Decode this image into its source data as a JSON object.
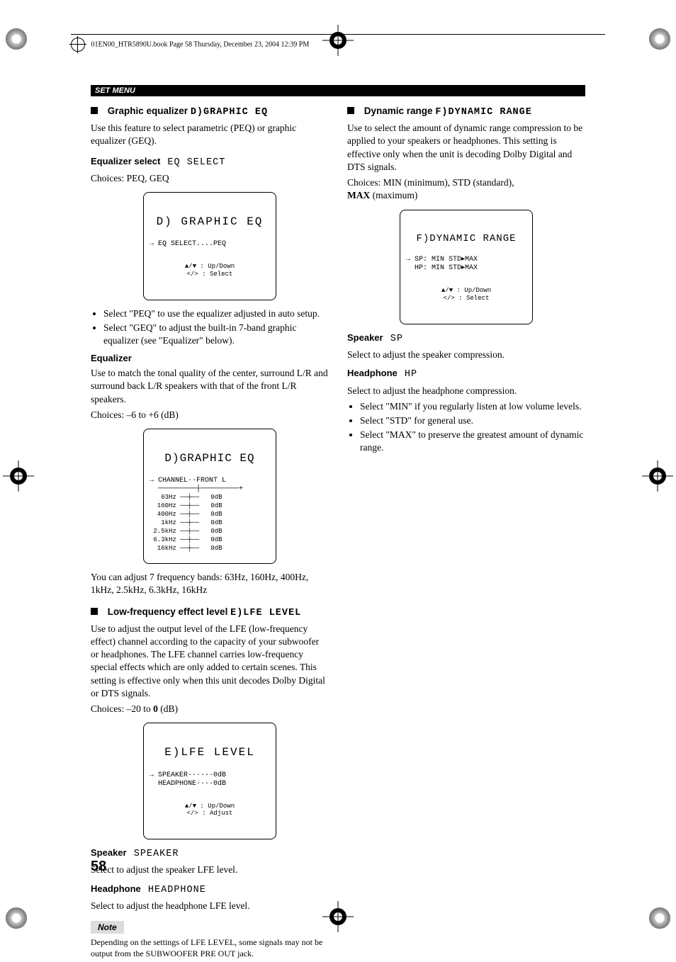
{
  "header": {
    "file_line": "01EN00_HTR5890U.book  Page 58  Thursday, December 23, 2004  12:39 PM"
  },
  "section_bar": "SET MENU",
  "page_number": "58",
  "left": {
    "h1_bold": "Graphic equalizer",
    "h1_osd": "D)GRAPHIC EQ",
    "p1": "Use this feature to select parametric (PEQ) or graphic equalizer (GEQ).",
    "eqsel_bold": "Equalizer select",
    "eqsel_osd": "EQ SELECT",
    "eqsel_choices": "Choices: PEQ, GEQ",
    "lcd1_title": "D) GRAPHIC EQ",
    "lcd1_line1": "→ EQ SELECT....PEQ",
    "lcd1_hint": "▲/▼ : Up/Down\n</> : Select",
    "bullets1": [
      "Select \"PEQ\" to use the equalizer adjusted in auto setup.",
      "Select \"GEQ\" to adjust the built-in 7-band graphic equalizer (see \"Equalizer\" below)."
    ],
    "eq_bold": "Equalizer",
    "eq_p": "Use to match the tonal quality of the center, surround L/R and surround back L/R speakers with that of the front L/R speakers.",
    "eq_choices": "Choices: –6 to +6 (dB)",
    "lcd2_title": "D)GRAPHIC EQ",
    "lcd2_line1": "→ CHANNEL··FRONT L",
    "lcd2_bands": "   63Hz ──┼──   0dB\n  160Hz ──┼──   0dB\n  400Hz ──┼──   0dB\n   1kHz ──┼──   0dB\n 2.5kHz ──┼──   0dB\n 6.3kHz ──┼──   0dB\n  16kHz ──┼──   0dB",
    "eq_after": "You can adjust 7 frequency bands: 63Hz, 160Hz, 400Hz, 1kHz, 2.5kHz, 6.3kHz, 16kHz",
    "h2_bold": "Low-frequency effect level",
    "h2_osd": "E)LFE LEVEL",
    "lfe_p": "Use to adjust the output level of the LFE (low-frequency effect) channel according to the capacity of your subwoofer or headphones. The LFE channel carries low-frequency special effects which are only added to certain scenes. This setting is effective only when this unit decodes Dolby Digital or DTS signals.",
    "lfe_choices_a": "Choices: –20 to ",
    "lfe_choices_b": "0",
    "lfe_choices_c": " (dB)",
    "lcd3_title": "E)LFE LEVEL",
    "lcd3_line1": "→ SPEAKER······0dB",
    "lcd3_line2": "  HEADPHONE····0dB",
    "lcd3_hint": "▲/▼ : Up/Down\n</> : Adjust",
    "sp_bold": "Speaker",
    "sp_osd": "SPEAKER",
    "sp_p": "Select to adjust the speaker LFE level.",
    "hp_bold": "Headphone",
    "hp_osd": "HEADPHONE",
    "hp_p": "Select to adjust the headphone LFE level.",
    "note_label": "Note",
    "note_p": "Depending on the settings of LFE LEVEL, some signals may not be output from the SUBWOOFER PRE OUT jack."
  },
  "right": {
    "h1_bold": "Dynamic range",
    "h1_osd": "F)DYNAMIC RANGE",
    "p1": "Use to select the amount of dynamic range compression to be applied to your speakers or headphones. This setting is effective only when the unit is decoding Dolby Digital and DTS signals.",
    "choices_a": "Choices: MIN (minimum), STD (standard), ",
    "choices_b": "MAX",
    "choices_c": " (maximum)",
    "lcd_title": "F)DYNAMIC RANGE",
    "lcd_line1": "→ SP: MIN STD▸MAX",
    "lcd_line2": "  HP: MIN STD▸MAX",
    "lcd_hint": "▲/▼ : Up/Down\n</> : Select",
    "sp_bold": "Speaker",
    "sp_osd": "SP",
    "sp_p": "Select to adjust the speaker compression.",
    "hp_bold": "Headphone",
    "hp_osd": "HP",
    "hp_p": "Select to adjust the headphone compression.",
    "bullets": [
      "Select \"MIN\" if you regularly listen at low volume levels.",
      "Select \"STD\" for general use.",
      "Select \"MAX\" to preserve the greatest amount of dynamic range."
    ]
  }
}
